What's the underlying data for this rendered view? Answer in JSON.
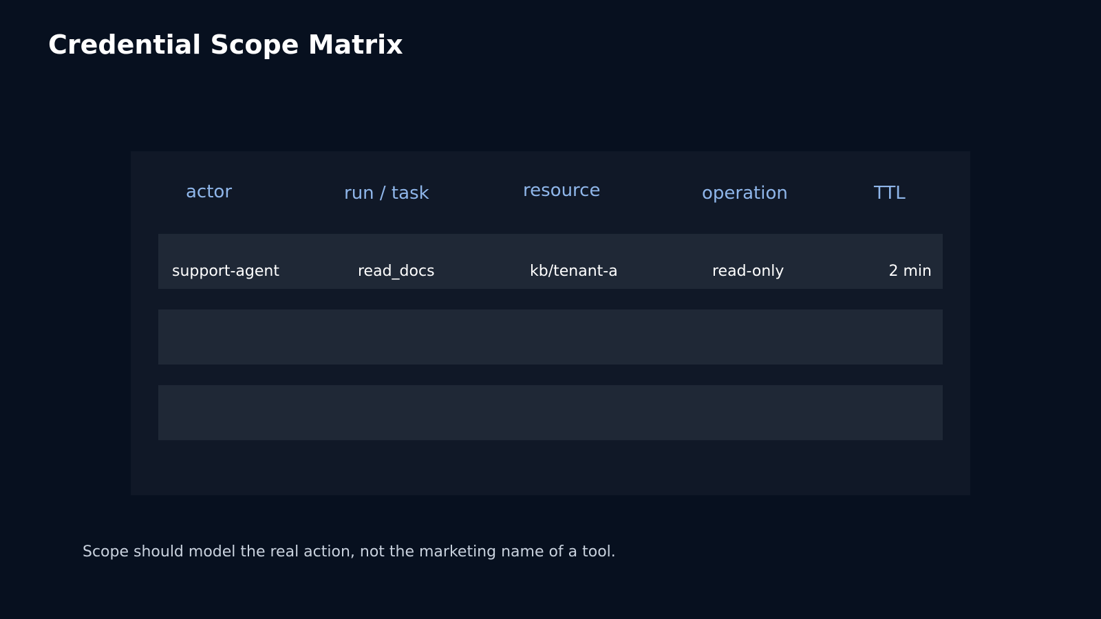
{
  "page": {
    "title": "Credential Scope Matrix",
    "footnote": "Scope should model the real action, not the marketing name of a tool."
  },
  "table": {
    "columns": [
      "actor",
      "run / task",
      "resource",
      "operation",
      "TTL"
    ],
    "rows": [
      {
        "actor": "support-agent",
        "run_task": "read_docs",
        "resource": "kb/tenant-a",
        "operation": "read-only",
        "ttl": "2 min"
      },
      {
        "actor": "",
        "run_task": "",
        "resource": "",
        "operation": "",
        "ttl": ""
      },
      {
        "actor": "",
        "run_task": "",
        "resource": "",
        "operation": "",
        "ttl": ""
      }
    ]
  },
  "colors": {
    "background": "#07101f",
    "panel": "#101827",
    "row": "#1f2836",
    "header_text": "#8fb6ea",
    "body_text": "#ffffff",
    "note_text": "#c9d2de"
  }
}
